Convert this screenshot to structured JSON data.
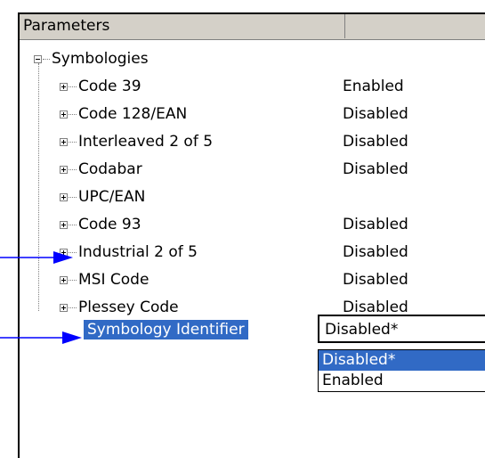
{
  "header": {
    "col_parameters": "Parameters",
    "col_value": ""
  },
  "tree": {
    "root": {
      "label": "Symbologies",
      "expanded": true
    },
    "items": [
      {
        "label": "Code 39",
        "value": "Enabled"
      },
      {
        "label": "Code 128/EAN",
        "value": "Disabled"
      },
      {
        "label": "Interleaved 2 of 5",
        "value": "Disabled"
      },
      {
        "label": "Codabar",
        "value": "Disabled"
      },
      {
        "label": "UPC/EAN",
        "value": ""
      },
      {
        "label": "Code 93",
        "value": "Disabled"
      },
      {
        "label": "Industrial 2 of 5",
        "value": "Disabled"
      },
      {
        "label": "MSI Code",
        "value": "Disabled"
      },
      {
        "label": "Plessey Code",
        "value": "Disabled"
      }
    ],
    "selected": {
      "label": "Symbology Identifier",
      "value": "Disabled*"
    }
  },
  "dropdown": {
    "current": "Disabled*",
    "options": [
      "Disabled*",
      "Enabled"
    ],
    "highlighted": "Disabled*"
  },
  "colors": {
    "selection": "#316ac5",
    "header_bg": "#d4d0c8",
    "arrow": "#0000ff"
  },
  "icons": [
    "expand-icon",
    "collapse-icon",
    "arrow-pointer"
  ]
}
